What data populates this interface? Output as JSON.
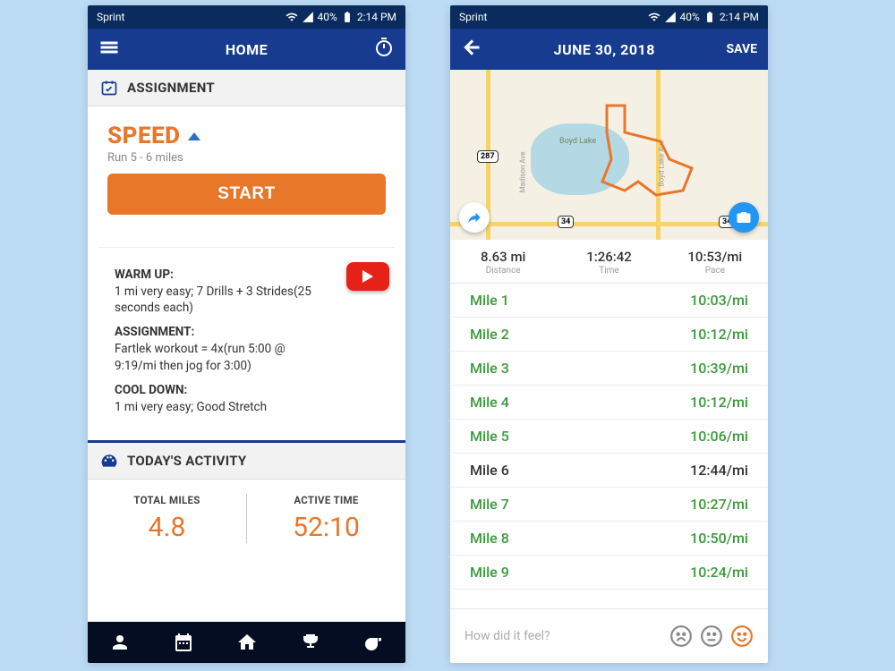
{
  "status": {
    "carrier": "Sprint",
    "battery": "40%",
    "time": "2:14 PM"
  },
  "phone1": {
    "title": "HOME",
    "sec_assignment": "ASSIGNMENT",
    "speed": "SPEED",
    "sub": "Run 5 - 6 miles",
    "start": "START",
    "warmup_h": "WARM UP:",
    "warmup": "1 mi very easy;   7 Drills + 3 Strides(25 seconds each)",
    "assign_h": "ASSIGNMENT:",
    "assign": "Fartlek workout = 4x(run 5:00 @ 9:19/mi then jog for 3:00)",
    "cool_h": "COOL DOWN:",
    "cool": "1 mi very easy; Good Stretch",
    "sec_activity": "TODAY'S ACTIVITY",
    "miles_l": "TOTAL MILES",
    "miles_v": "4.8",
    "time_l": "ACTIVE TIME",
    "time_v": "52:10"
  },
  "phone2": {
    "title": "JUNE 30, 2018",
    "save": "SAVE",
    "map": {
      "lake": "Boyd Lake",
      "hwy1": "287",
      "hwy2": "34",
      "hwy3": "34",
      "st1": "Madison Ave",
      "st2": "Boyd Lake Ave"
    },
    "stats": [
      {
        "v": "8.63 mi",
        "l": "Distance"
      },
      {
        "v": "1:26:42",
        "l": "Time"
      },
      {
        "v": "10:53/mi",
        "l": "Pace"
      }
    ],
    "splits": [
      {
        "n": "Mile 1",
        "p": "10:03/mi",
        "c": "good"
      },
      {
        "n": "Mile 2",
        "p": "10:12/mi",
        "c": "good"
      },
      {
        "n": "Mile 3",
        "p": "10:39/mi",
        "c": "good"
      },
      {
        "n": "Mile 4",
        "p": "10:12/mi",
        "c": "good"
      },
      {
        "n": "Mile 5",
        "p": "10:06/mi",
        "c": "good"
      },
      {
        "n": "Mile 6",
        "p": "12:44/mi",
        "c": "norm"
      },
      {
        "n": "Mile 7",
        "p": "10:27/mi",
        "c": "good"
      },
      {
        "n": "Mile 8",
        "p": "10:50/mi",
        "c": "good"
      },
      {
        "n": "Mile 9",
        "p": "10:24/mi",
        "c": "good"
      }
    ],
    "feedback": "How did it feel?"
  }
}
